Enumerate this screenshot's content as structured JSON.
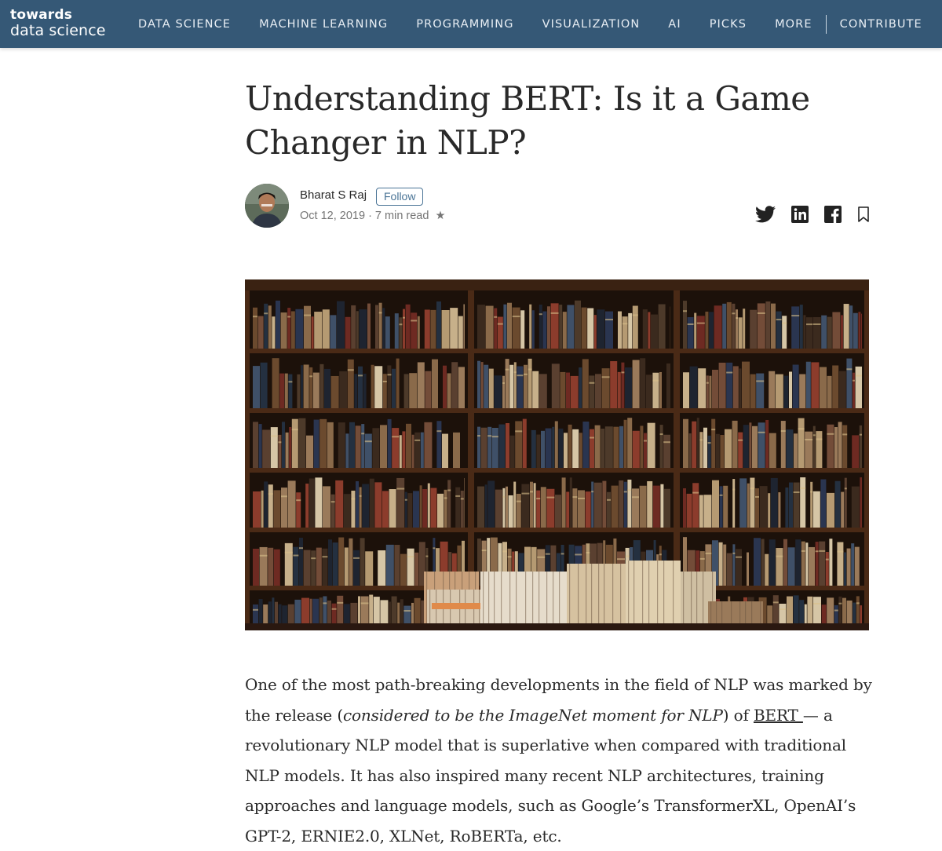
{
  "header": {
    "logo_line1": "towards",
    "logo_line2": "data science",
    "nav": [
      "DATA SCIENCE",
      "MACHINE LEARNING",
      "PROGRAMMING",
      "VISUALIZATION",
      "AI",
      "PICKS",
      "MORE"
    ],
    "contribute": "CONTRIBUTE",
    "bg_color": "#355876"
  },
  "article": {
    "title": "Understanding BERT: Is it a Game Changer in NLP?",
    "author": "Bharat S Raj",
    "follow_label": "Follow",
    "date": "Oct 12, 2019",
    "read_time": "7 min read",
    "star": "★",
    "share_icons": [
      "twitter-icon",
      "linkedin-icon",
      "facebook-icon",
      "bookmark-icon"
    ],
    "hero_alt": "bookshelf photo",
    "body": {
      "p1_a": "One of the most path-breaking developments in the field of NLP was marked by the release (",
      "p1_em": "considered to be the ImageNet moment for NLP",
      "p1_b": ") of ",
      "p1_link": "BERT ",
      "p1_c": "— a revolutionary NLP model that is superlative when compared with traditional NLP models. It has also inspired many recent NLP architectures, training approaches and language models, such as Google’s TransformerXL, OpenAI’s GPT-2, ERNIE2.0, XLNet, RoBERTa, etc."
    }
  }
}
